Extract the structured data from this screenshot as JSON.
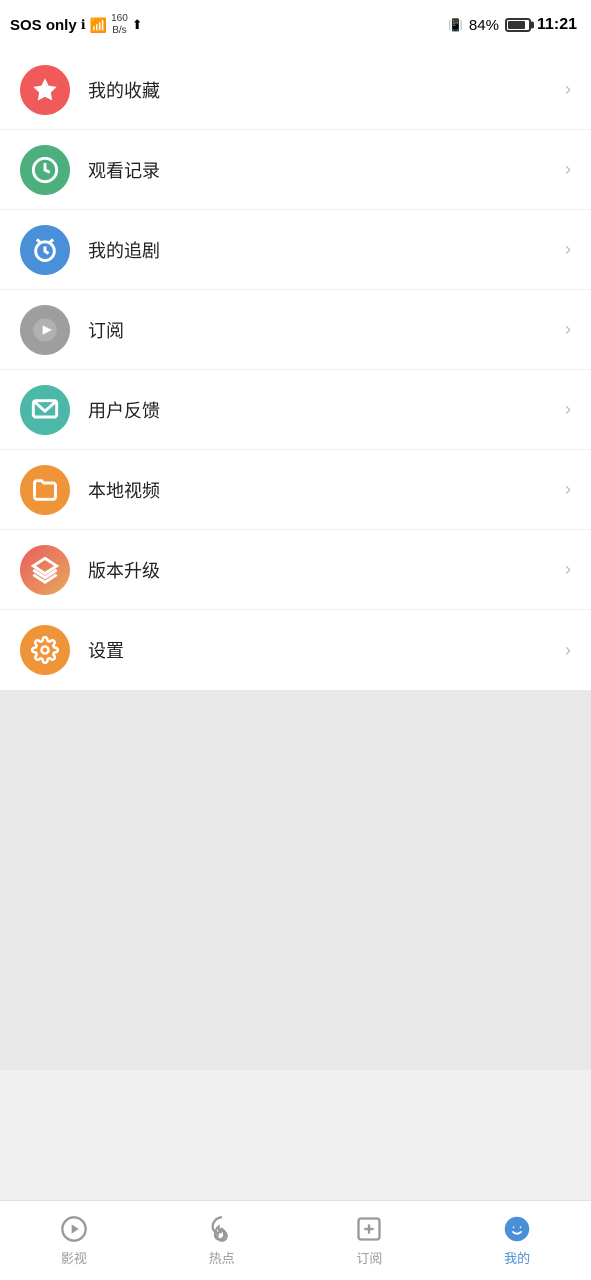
{
  "statusBar": {
    "sos": "SOS only",
    "dataSpeed": "160\nB/s",
    "batteryPercent": "84%",
    "time": "11:21"
  },
  "menuItems": [
    {
      "id": "favorites",
      "label": "我的收藏",
      "iconColor": "icon-red",
      "iconType": "star"
    },
    {
      "id": "history",
      "label": "观看记录",
      "iconColor": "icon-green",
      "iconType": "clock"
    },
    {
      "id": "follow",
      "label": "我的追剧",
      "iconColor": "icon-blue",
      "iconType": "alarm"
    },
    {
      "id": "subscribe",
      "label": "订阅",
      "iconColor": "icon-gray",
      "iconType": "play"
    },
    {
      "id": "feedback",
      "label": "用户反馈",
      "iconColor": "icon-teal",
      "iconType": "message"
    },
    {
      "id": "local",
      "label": "本地视频",
      "iconColor": "icon-orange",
      "iconType": "folder"
    },
    {
      "id": "update",
      "label": "版本升级",
      "iconColor": "icon-multi",
      "iconType": "layers"
    },
    {
      "id": "settings",
      "label": "设置",
      "iconColor": "icon-yellow",
      "iconType": "gear"
    }
  ],
  "tabBar": {
    "items": [
      {
        "id": "movies",
        "label": "影视",
        "iconType": "play-circle"
      },
      {
        "id": "hot",
        "label": "热点",
        "iconType": "fire"
      },
      {
        "id": "subscribe",
        "label": "订阅",
        "iconType": "plus-square"
      },
      {
        "id": "mine",
        "label": "我的",
        "iconType": "smiley",
        "active": true
      }
    ]
  }
}
